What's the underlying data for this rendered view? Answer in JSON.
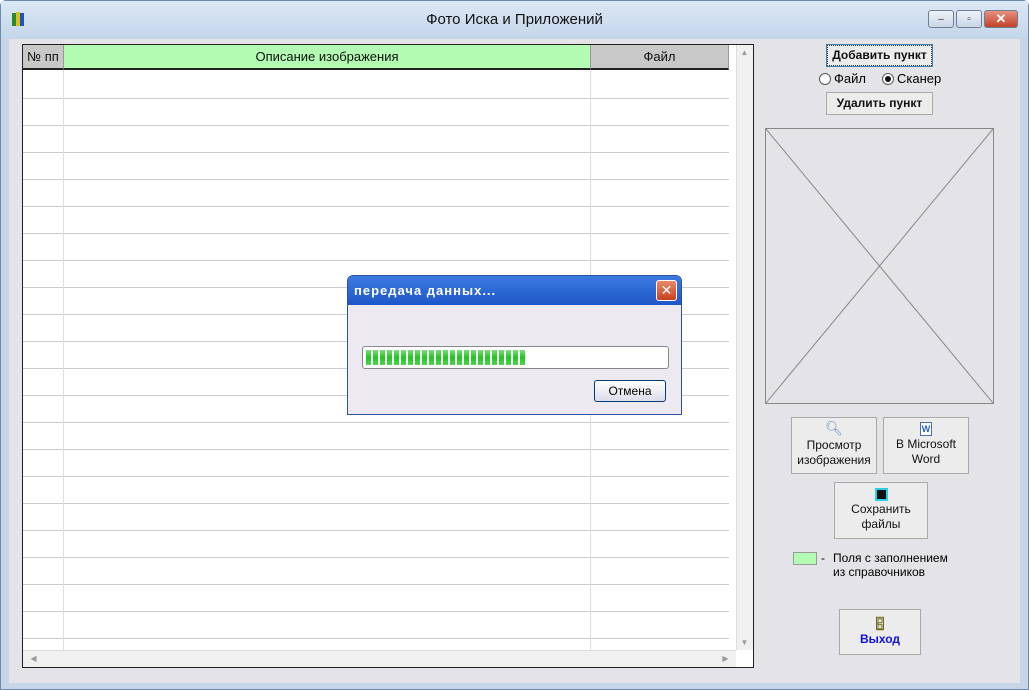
{
  "window": {
    "title": "Фото Иска и Приложений",
    "minimize": "–",
    "maximize": "▫",
    "close": "✕"
  },
  "grid": {
    "columns": [
      "№ пп",
      "Описание изображения",
      "Файл"
    ],
    "row_count": 21,
    "header_accent": "#b3fbb3"
  },
  "side": {
    "add_item": "Добавить пункт",
    "source_options": [
      {
        "label": "Файл",
        "selected": false
      },
      {
        "label": "Сканер",
        "selected": true
      }
    ],
    "delete_item": "Удалить пункт",
    "view_image": [
      "Просмотр",
      "изображения"
    ],
    "to_word": [
      "В Microsoft",
      "Word"
    ],
    "save_files": [
      "Сохранить",
      "файлы"
    ],
    "legend_dash": "-",
    "legend_text": [
      "Поля с заполнением",
      "из справочников"
    ],
    "exit": "Выход"
  },
  "dialog": {
    "title": "передача данных...",
    "close": "✕",
    "progress_percent": 53,
    "cancel": "Отмена"
  }
}
